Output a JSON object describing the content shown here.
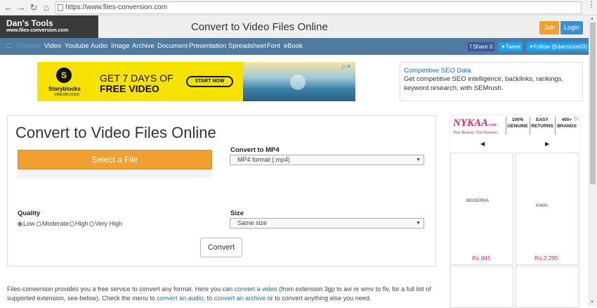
{
  "browser": {
    "url": "https://www.files-conversion.com"
  },
  "logo": {
    "title": "Dan's Tools",
    "subtitle": "www.files-conversion.com"
  },
  "header": {
    "title": "Convert to Video Files Online",
    "join": "Join",
    "login": "Login"
  },
  "nav": {
    "related": "Related:",
    "items": [
      "Video",
      "Youtube",
      "Audio",
      "Image",
      "Archive",
      "Document",
      "Presentation",
      "Spreadsheet",
      "Font",
      "eBook"
    ],
    "share": "Share 0",
    "tweet": "Tweet",
    "follow": "Follow @danstools00"
  },
  "ad_banner": {
    "brand": "Storyblocks",
    "brand_sub": "VIDEOBLOCKS",
    "line1": "GET 7 DAYS OF",
    "line2": "FREE VIDEO",
    "cta": "START NOW"
  },
  "text_ad": {
    "title": "Competitive SEO Data",
    "body": "Get competitive SEO intelligence, backlinks, rankings, keyword research, with SEMrush."
  },
  "converter": {
    "title": "Convert to Video Files Online",
    "select_file": "Select a File",
    "convert_to_label": "Convert to MP4",
    "format_value": "MP4 format (.mp4)",
    "quality_label": "Quality",
    "quality_options": [
      "Low",
      "Moderate",
      "High",
      "Very High"
    ],
    "quality_selected": "Low",
    "size_label": "Size",
    "size_value": "Same size",
    "convert_button": "Convert"
  },
  "side_ad": {
    "brand": "NYKAA",
    "brand_suffix": ".com",
    "tagline": "Your Beauty. Our Passion.",
    "badges": [
      "100% GENUINE",
      "EASY RETURNS",
      "400+ BRANDS"
    ],
    "products": [
      {
        "name": "BIODERMA",
        "price": "Rs.945"
      },
      {
        "name": "KAMA",
        "price": "Rs.2,295"
      }
    ]
  },
  "footer": {
    "t1": "Files-conversion provides you a free service to convert any format. Here you can ",
    "l1": "convert a video",
    "t2": " (from extension 3gp to avi or wmv to flv, for a full list of supported extension, see-below). Check the menu to ",
    "l2": "convert an audio",
    "t3": ", to ",
    "l3": "convert an archive",
    "t4": " or to convert anything else you need."
  },
  "colors": {
    "nav": "#4f7ba1",
    "accent": "#f0a030",
    "join": "#f0a030",
    "login": "#3b8ed0"
  }
}
